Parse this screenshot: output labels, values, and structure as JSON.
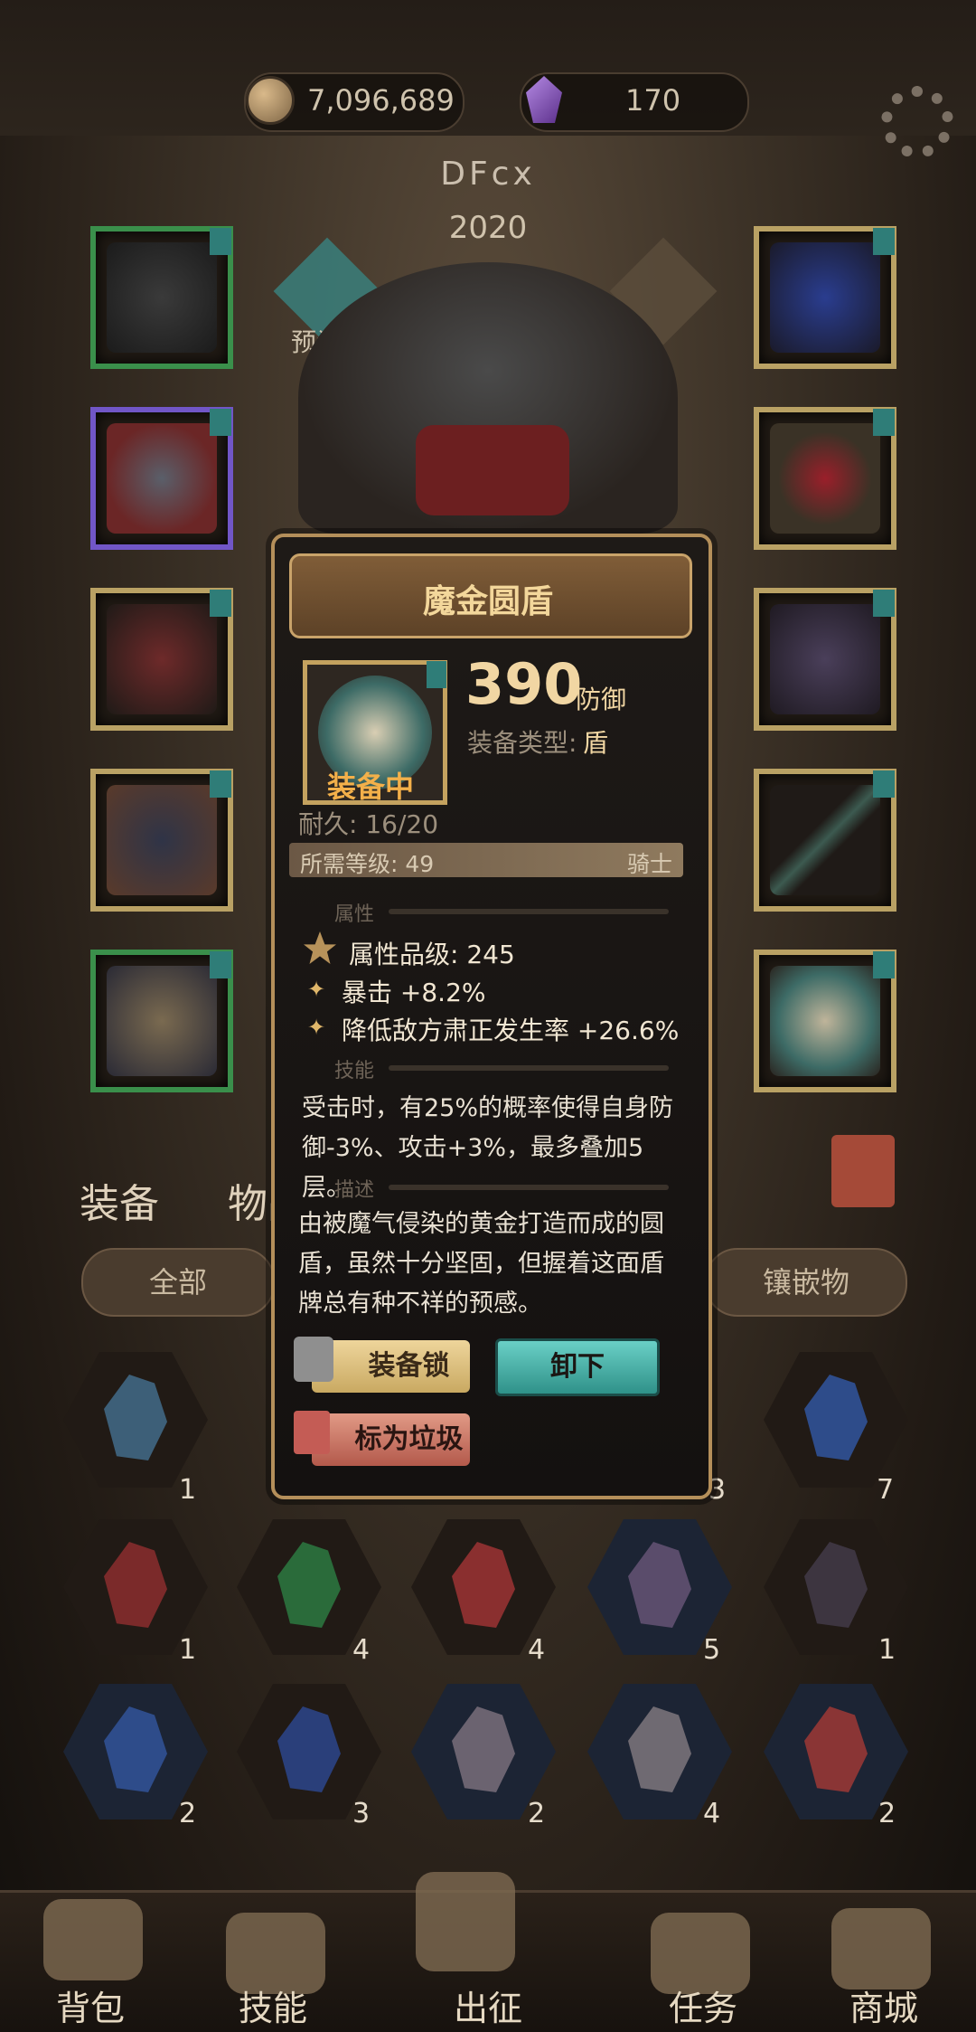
{
  "header": {
    "gold": "7,096,689",
    "gems": "170",
    "player_name": "DFcx",
    "player_level": "2020",
    "preset_label": "预设一"
  },
  "popup": {
    "title": "魔金圆盾",
    "defense_value": "390",
    "defense_unit": "防御",
    "type_label": "装备类型:",
    "type_value": "盾",
    "equipped_label": "装备中",
    "durability": "耐久: 16/20",
    "required_level": "所需等级: 49",
    "class_name": "骑士",
    "section_attributes": "属性",
    "attribute_grade": "属性品级: 245",
    "stat_1": "暴击 +8.2%",
    "stat_2": "降低敌方肃正发生率 +26.6%",
    "section_skill": "技能",
    "skill_text": "受击时，有25%的概率使得自身防御-3%、攻击+3%，最多叠加5层。",
    "section_desc": "描述",
    "description": "由被魔气侵染的黄金打造而成的圆盾，虽然十分坚固，但握着这面盾牌总有种不祥的预感。",
    "lock_button": "装备锁",
    "unequip_button": "卸下",
    "junk_button": "标为垃圾"
  },
  "tabs": {
    "equipment": "装备",
    "items": "物品"
  },
  "filters": {
    "all": "全部",
    "inlay": "镶嵌物"
  },
  "inventory": {
    "row1_counts": [
      "1",
      "3",
      "7"
    ],
    "row2_counts": [
      "1",
      "4",
      "4",
      "5",
      "1"
    ],
    "row3_counts": [
      "2",
      "3",
      "2",
      "4",
      "2"
    ]
  },
  "nav": {
    "bag": "背包",
    "skills": "技能",
    "expedition": "出征",
    "quests": "任务",
    "shop": "商城"
  },
  "colors": {
    "accent_gold": "#c4a25f",
    "teal": "#2f9189",
    "equipped_orange": "#f3b04a"
  }
}
